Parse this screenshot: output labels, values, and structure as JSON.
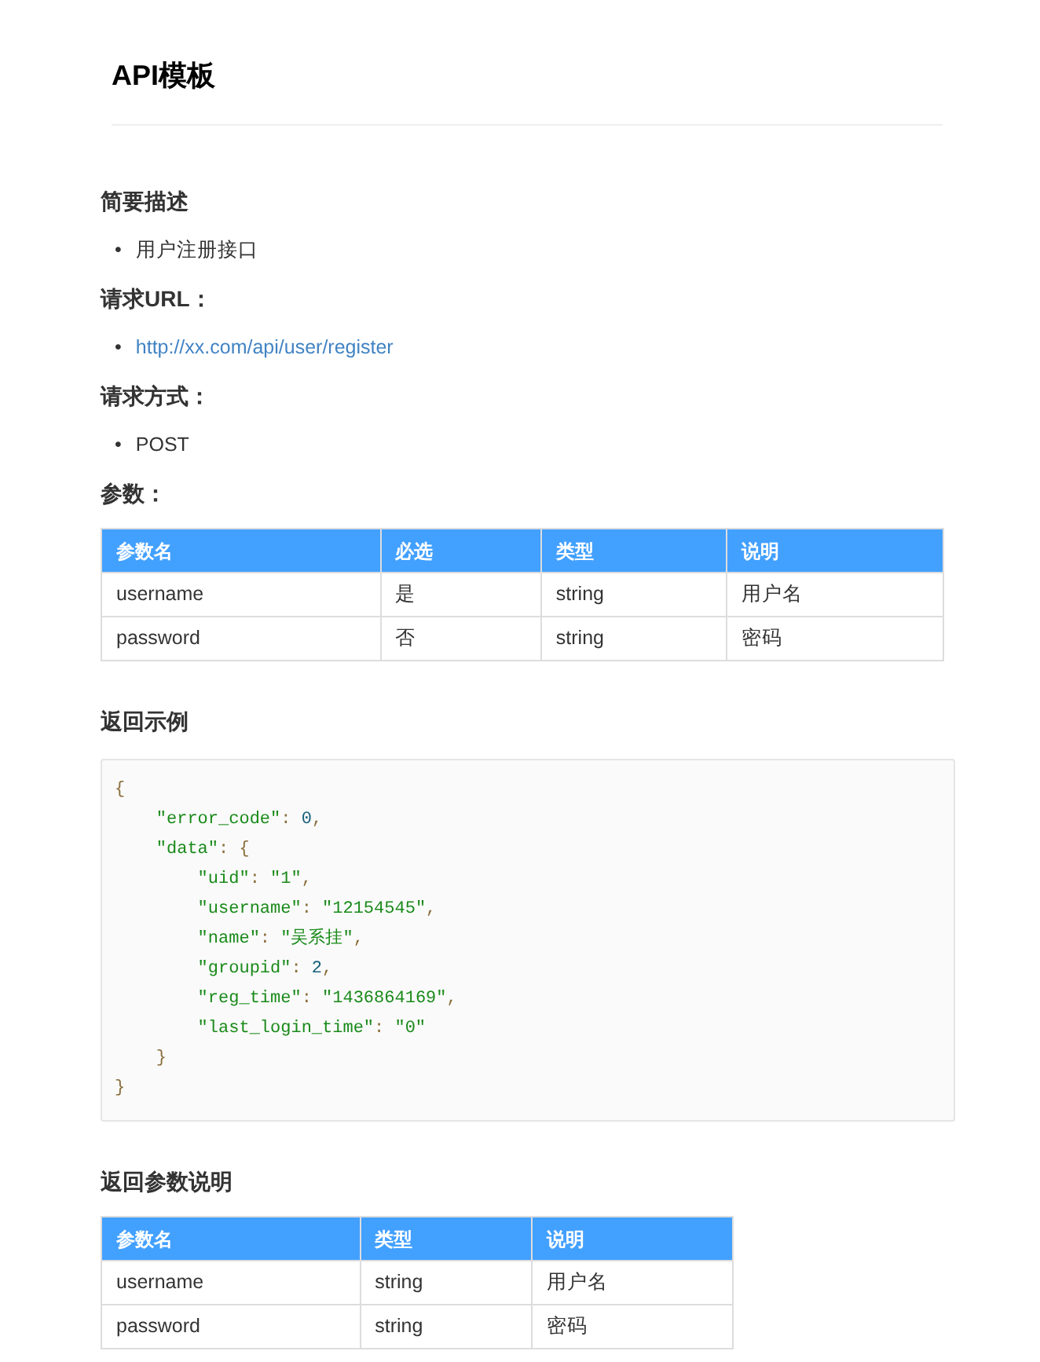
{
  "title": "API模板",
  "sections": [
    {
      "heading": "简要描述",
      "kind": "list",
      "items": [
        {
          "bullet": "•",
          "text": "用户注册接口",
          "kind": "text"
        }
      ]
    },
    {
      "heading": "请求URL：",
      "kind": "list",
      "items": [
        {
          "bullet": "•",
          "text": "http://xx.com/api/user/register",
          "kind": "link"
        }
      ]
    },
    {
      "heading": "请求方式：",
      "kind": "list",
      "items": [
        {
          "bullet": "•",
          "text": "POST",
          "kind": "text"
        }
      ]
    },
    {
      "heading": "参数：",
      "kind": "table",
      "columns": [
        "参数名",
        "必选",
        "类型",
        "说明"
      ],
      "rows": [
        [
          "username",
          "是",
          "string",
          "用户名"
        ],
        [
          "password",
          "否",
          "string",
          "密码"
        ]
      ]
    },
    {
      "heading": "返回示例",
      "kind": "code",
      "lines": [
        [
          {
            "t": "{",
            "kind": "punct"
          }
        ],
        [
          {
            "t": "    \"error_code\"",
            "kind": "string"
          },
          {
            "t": ": ",
            "kind": "punct"
          },
          {
            "t": "0",
            "kind": "number"
          },
          {
            "t": ",",
            "kind": "punct"
          }
        ],
        [
          {
            "t": "    \"data\"",
            "kind": "string"
          },
          {
            "t": ": {",
            "kind": "punct"
          }
        ],
        [
          {
            "t": "        \"uid\"",
            "kind": "string"
          },
          {
            "t": ": ",
            "kind": "punct"
          },
          {
            "t": "\"1\"",
            "kind": "string"
          },
          {
            "t": ",",
            "kind": "punct"
          }
        ],
        [
          {
            "t": "        \"username\"",
            "kind": "string"
          },
          {
            "t": ": ",
            "kind": "punct"
          },
          {
            "t": "\"12154545\"",
            "kind": "string"
          },
          {
            "t": ",",
            "kind": "punct"
          }
        ],
        [
          {
            "t": "        \"name\"",
            "kind": "string"
          },
          {
            "t": ": ",
            "kind": "punct"
          },
          {
            "t": "\"吴系挂\"",
            "kind": "string"
          },
          {
            "t": ",",
            "kind": "punct"
          }
        ],
        [
          {
            "t": "        \"groupid\"",
            "kind": "string"
          },
          {
            "t": ": ",
            "kind": "punct"
          },
          {
            "t": "2",
            "kind": "number"
          },
          {
            "t": ",",
            "kind": "punct"
          }
        ],
        [
          {
            "t": "        \"reg_time\"",
            "kind": "string"
          },
          {
            "t": ": ",
            "kind": "punct"
          },
          {
            "t": "\"1436864169\"",
            "kind": "string"
          },
          {
            "t": ",",
            "kind": "punct"
          }
        ],
        [
          {
            "t": "        \"last_login_time\"",
            "kind": "string"
          },
          {
            "t": ": ",
            "kind": "punct"
          },
          {
            "t": "\"0\"",
            "kind": "string"
          }
        ],
        [
          {
            "t": "    }",
            "kind": "punct"
          }
        ],
        [
          {
            "t": "}",
            "kind": "punct"
          }
        ]
      ]
    },
    {
      "heading": "返回参数说明",
      "kind": "table",
      "columns": [
        "参数名",
        "类型",
        "说明"
      ],
      "rows": [
        [
          "username",
          "string",
          "用户名"
        ],
        [
          "password",
          "string",
          "密码"
        ]
      ]
    }
  ]
}
